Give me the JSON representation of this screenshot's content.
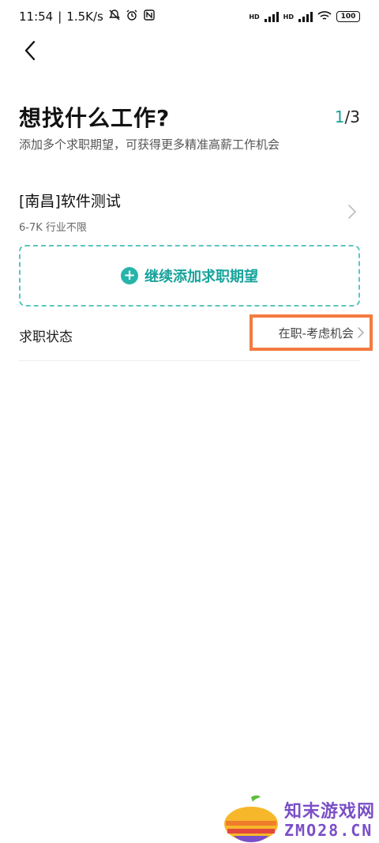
{
  "status_bar": {
    "time": "11:54",
    "network_speed": "1.5K/s",
    "hd1": "HD",
    "hd2": "HD",
    "battery": "100",
    "icons": [
      "bell-muted-icon",
      "alarm-icon",
      "nfc-icon",
      "signal-icon",
      "wifi-icon",
      "battery-icon"
    ]
  },
  "header": {
    "title": "想找什么工作?",
    "step_current": "1",
    "step_total": "/3",
    "subtitle": "添加多个求职期望，可获得更多精准高薪工作机会"
  },
  "preference": {
    "title": "[南昌]软件测试",
    "meta": "6-7K 行业不限"
  },
  "add_more": {
    "label": "继续添加求职期望"
  },
  "job_status": {
    "label": "求职状态",
    "value": "在职-考虑机会"
  },
  "watermark": {
    "cn": "知末游戏网",
    "en": "ZMO28.CN"
  },
  "colors": {
    "accent": "#18a39a",
    "highlight": "#f47b3f",
    "watermark": "#7a4fc7"
  }
}
